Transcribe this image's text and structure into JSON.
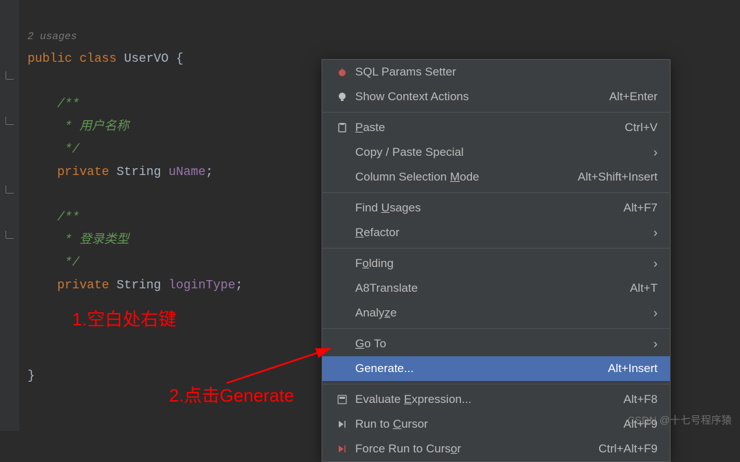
{
  "usages_label": "2 usages",
  "code": {
    "line_decl": {
      "kw1": "public",
      "kw2": "class",
      "cls": "UserVO",
      "brace": " {"
    },
    "comment1_open": "/**",
    "comment1_body": " * 用户名称",
    "comment1_close": " */",
    "field1": {
      "kw": "private",
      "type": "String",
      "name": "uName",
      "semi": ";"
    },
    "comment2_open": "/**",
    "comment2_body": " * 登录类型",
    "comment2_close": " */",
    "field2": {
      "kw": "private",
      "type": "String",
      "name": "loginType",
      "semi": ";"
    },
    "close": "}"
  },
  "menu": {
    "sql_params": "SQL Params Setter",
    "context_actions": {
      "label": "Show Context Actions",
      "shortcut": "Alt+Enter"
    },
    "paste": {
      "pre": "",
      "u": "P",
      "post": "aste",
      "shortcut": "Ctrl+V"
    },
    "copy_paste": {
      "label": "Copy / Paste Special"
    },
    "col_select": {
      "pre": "Column Selection ",
      "u": "M",
      "post": "ode",
      "shortcut": "Alt+Shift+Insert"
    },
    "find_usages": {
      "pre": "Find ",
      "u": "U",
      "post": "sages",
      "shortcut": "Alt+F7"
    },
    "refactor": {
      "pre": "",
      "u": "R",
      "post": "efactor"
    },
    "folding": {
      "pre": "F",
      "u": "o",
      "post": "lding"
    },
    "a8": {
      "label": "A8Translate",
      "shortcut": "Alt+T"
    },
    "analyze": {
      "pre": "Analy",
      "u": "z",
      "post": "e"
    },
    "goto": {
      "pre": "",
      "u": "G",
      "post": "o To"
    },
    "generate": {
      "label": "Generate...",
      "shortcut": "Alt+Insert"
    },
    "eval_expr": {
      "pre": "Evaluate ",
      "u": "E",
      "post": "xpression...",
      "shortcut": "Alt+F8"
    },
    "run_cursor": {
      "pre": "Run to ",
      "u": "C",
      "post": "ursor",
      "shortcut": "Alt+F9"
    },
    "force_run": {
      "pre": "Force Run to Curs",
      "u": "o",
      "post": "r",
      "shortcut": "Ctrl+Alt+F9"
    }
  },
  "annotations": {
    "step1": "1.空白处右键",
    "step2": "2.点击Generate"
  },
  "watermark": "CSDN @十七号程序猿"
}
